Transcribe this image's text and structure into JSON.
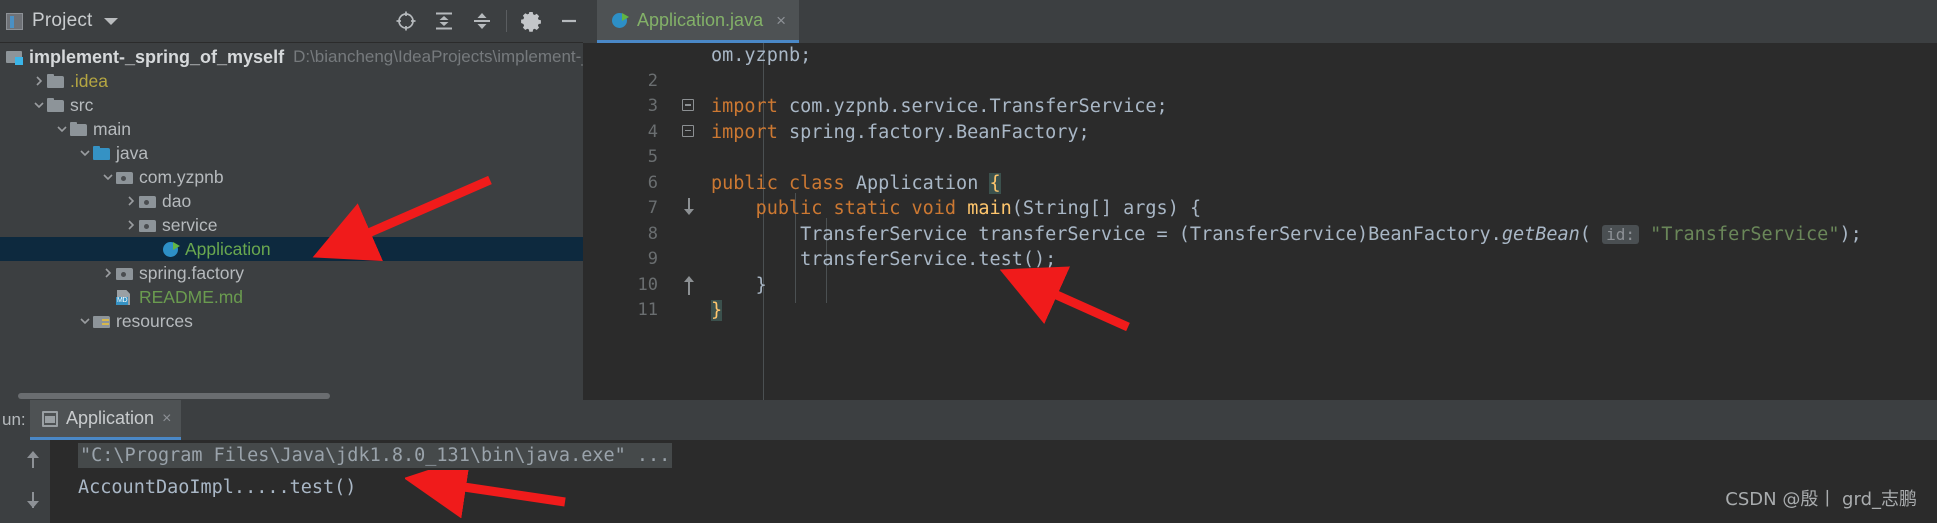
{
  "project_panel": {
    "title": "Project",
    "title_icon": "project-view-icon",
    "tools": [
      {
        "name": "locate-in-tree-icon",
        "label": "⊕"
      },
      {
        "name": "expand-all-icon",
        "label": "⇶"
      },
      {
        "name": "collapse-all-icon",
        "label": "⇷"
      },
      {
        "name": "settings-gear-icon",
        "label": "⚙"
      },
      {
        "name": "hide-panel-icon",
        "label": "—"
      }
    ],
    "root": {
      "label": "implement-_spring_of_myself",
      "path": "D:\\biancheng\\IdeaProjects\\implement-_spring_of_myself"
    },
    "nodes": [
      {
        "label": ".idea",
        "indent": 1,
        "arrow": "collapsed",
        "icon": "folder",
        "color": "yellowish"
      },
      {
        "label": "src",
        "indent": 1,
        "arrow": "expanded",
        "icon": "folder",
        "color": "plain"
      },
      {
        "label": "main",
        "indent": 2,
        "arrow": "expanded",
        "icon": "folder",
        "color": "plain"
      },
      {
        "label": "java",
        "indent": 3,
        "arrow": "expanded",
        "icon": "folder-src",
        "color": "plain"
      },
      {
        "label": "com.yzpnb",
        "indent": 4,
        "arrow": "expanded",
        "icon": "package",
        "color": "plain"
      },
      {
        "label": "dao",
        "indent": 5,
        "arrow": "collapsed",
        "icon": "package",
        "color": "plain"
      },
      {
        "label": "service",
        "indent": 5,
        "arrow": "collapsed",
        "icon": "package",
        "color": "plain"
      },
      {
        "label": "Application",
        "indent": 6,
        "arrow": "none",
        "icon": "class-run",
        "color": "green",
        "selected": true
      },
      {
        "label": "spring.factory",
        "indent": 4,
        "arrow": "collapsed",
        "icon": "package",
        "color": "plain"
      },
      {
        "label": "README.md",
        "indent": 4,
        "arrow": "none",
        "icon": "md",
        "color": "greenish"
      },
      {
        "label": "resources",
        "indent": 3,
        "arrow": "expanded",
        "icon": "folder-res",
        "color": "plain"
      }
    ]
  },
  "editor": {
    "tab": {
      "label": "Application.java",
      "icon": "java-class-run-icon",
      "close": "×"
    },
    "lines": [
      {
        "num": "",
        "text_html": "",
        "kind": "pkg"
      },
      {
        "num": "2",
        "kind": "blank"
      },
      {
        "num": "3",
        "kind": "import",
        "fold": "minus"
      },
      {
        "num": "4",
        "kind": "import2",
        "fold": "minus"
      },
      {
        "num": "5",
        "kind": "blank"
      },
      {
        "num": "6",
        "kind": "class",
        "runmark": true
      },
      {
        "num": "7",
        "kind": "method",
        "runmark": true,
        "fold": "arrow-dn"
      },
      {
        "num": "8",
        "kind": "stmt1"
      },
      {
        "num": "9",
        "kind": "stmt2"
      },
      {
        "num": "10",
        "kind": "closebrace1",
        "fold": "arrow-up"
      },
      {
        "num": "11",
        "kind": "closebrace2"
      }
    ],
    "code": {
      "package_tail": "om.yzpnb;",
      "import1_kw": "import",
      "import1_val": " com.yzpnb.service.TransferService;",
      "import2_kw": "import",
      "import2_val": " spring.factory.BeanFactory;",
      "class_kw1": "public",
      "class_kw2": "class",
      "class_name": "Application",
      "class_brace": "{",
      "m_kw1": "public",
      "m_kw2": "static",
      "m_kw3": "void",
      "m_name": "main",
      "m_args": "(String[] args) {",
      "s1_a": "TransferService transferService = (TransferService)BeanFactory.",
      "s1_fn": "getBean",
      "s1_open": "(",
      "s1_hint": "id:",
      "s1_str": "\"TransferService\"",
      "s1_end": ");",
      "s2": "transferService.test();",
      "brace_inner": "}",
      "brace_outer": "}"
    }
  },
  "run_panel": {
    "run_label": "un:",
    "tab": {
      "label": "Application",
      "icon": "console-window-icon",
      "close": "×"
    },
    "nav": {
      "up": "scroll-up-icon",
      "down": "scroll-down-icon"
    },
    "console_lines": [
      {
        "text": "\"C:\\Program Files\\Java\\jdk1.8.0_131\\bin\\java.exe\" ...",
        "style": "cmd"
      },
      {
        "text": "AccountDaoImpl.....test()",
        "style": "out"
      }
    ]
  },
  "watermark": "CSDN @殷丨 grd_志鹏",
  "colors": {
    "panel_bg": "#3c3f41",
    "editor_bg": "#2b2b2b",
    "selection": "#0d293e",
    "accent": "#4a88c7",
    "keyword": "#cc7832",
    "string": "#6a8759",
    "method": "#ffc66d",
    "text": "#a9b7c6",
    "annotation_arrow": "#f01b1b"
  }
}
